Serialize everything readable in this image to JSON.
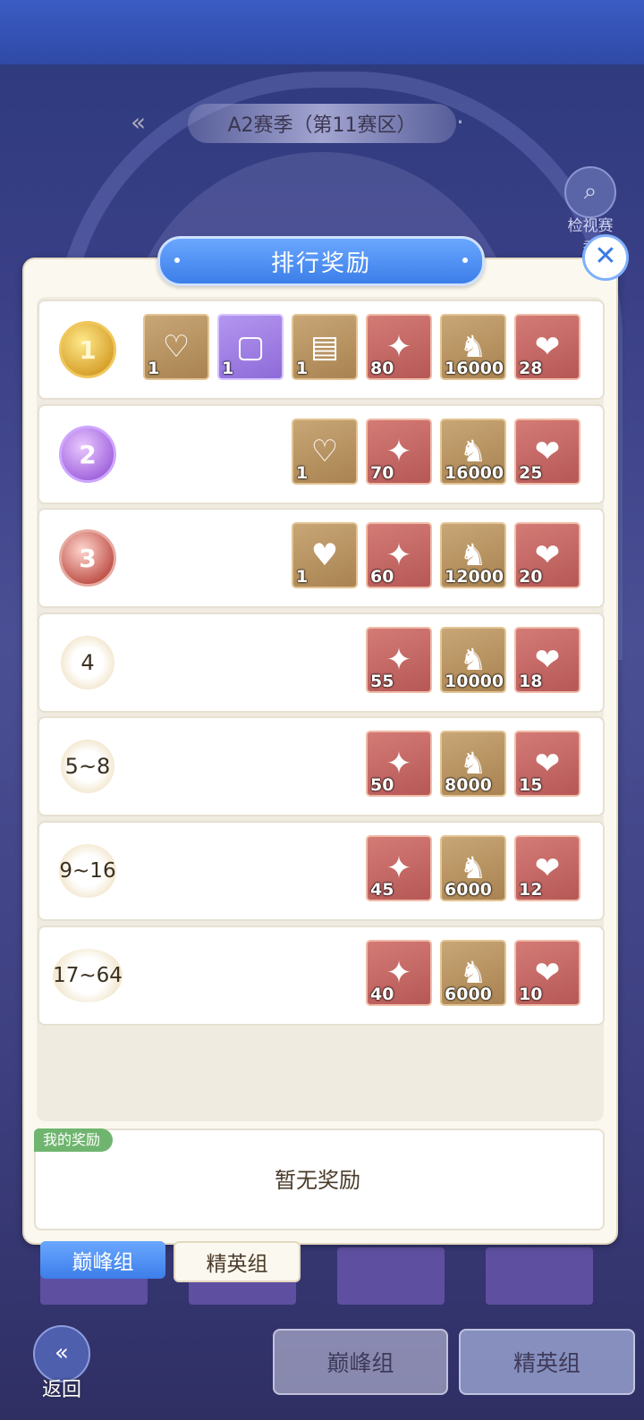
{
  "season": {
    "label": "A2赛季（第11赛区）"
  },
  "view_season": {
    "label": "检视赛季"
  },
  "panel": {
    "title": "排行奖励",
    "close_icon": "close-icon"
  },
  "ranks": [
    {
      "label": "1",
      "items": [
        {
          "icon": "silver-heart-emblem-icon",
          "qty": "1",
          "bg": "brown"
        },
        {
          "icon": "golden-frame-icon",
          "qty": "1",
          "bg": "purple"
        },
        {
          "icon": "title-card-icon",
          "qty": "1",
          "bg": "brown"
        },
        {
          "icon": "character-token-icon",
          "qty": "80",
          "bg": "red"
        },
        {
          "icon": "dragon-icon",
          "qty": "16000",
          "bg": "brown"
        },
        {
          "icon": "lips-icon",
          "qty": "28",
          "bg": "red"
        }
      ]
    },
    {
      "label": "2",
      "items": [
        {
          "icon": "silver-heart-emblem-icon",
          "qty": "1",
          "bg": "brown"
        },
        {
          "icon": "character-token-icon",
          "qty": "70",
          "bg": "red"
        },
        {
          "icon": "dragon-icon",
          "qty": "16000",
          "bg": "brown"
        },
        {
          "icon": "lips-icon",
          "qty": "25",
          "bg": "red"
        }
      ]
    },
    {
      "label": "3",
      "items": [
        {
          "icon": "dark-heart-emblem-icon",
          "qty": "1",
          "bg": "brown"
        },
        {
          "icon": "character-token-icon",
          "qty": "60",
          "bg": "red"
        },
        {
          "icon": "dragon-icon",
          "qty": "12000",
          "bg": "brown"
        },
        {
          "icon": "lips-icon",
          "qty": "20",
          "bg": "red"
        }
      ]
    },
    {
      "label": "4",
      "items": [
        {
          "icon": "character-token-icon",
          "qty": "55",
          "bg": "red"
        },
        {
          "icon": "dragon-icon",
          "qty": "10000",
          "bg": "brown"
        },
        {
          "icon": "lips-icon",
          "qty": "18",
          "bg": "red"
        }
      ]
    },
    {
      "label": "5~8",
      "items": [
        {
          "icon": "character-token-icon",
          "qty": "50",
          "bg": "red"
        },
        {
          "icon": "dragon-icon",
          "qty": "8000",
          "bg": "brown"
        },
        {
          "icon": "lips-icon",
          "qty": "15",
          "bg": "red"
        }
      ]
    },
    {
      "label": "9~16",
      "items": [
        {
          "icon": "character-token-icon",
          "qty": "45",
          "bg": "red"
        },
        {
          "icon": "dragon-icon",
          "qty": "6000",
          "bg": "brown"
        },
        {
          "icon": "lips-icon",
          "qty": "12",
          "bg": "red"
        }
      ]
    },
    {
      "label": "17~64",
      "items": [
        {
          "icon": "character-token-icon",
          "qty": "40",
          "bg": "red"
        },
        {
          "icon": "dragon-icon",
          "qty": "6000",
          "bg": "brown"
        },
        {
          "icon": "lips-icon",
          "qty": "10",
          "bg": "red"
        }
      ]
    }
  ],
  "my_reward": {
    "tag": "我的奖励",
    "text": "暂无奖励"
  },
  "tabs": {
    "peak": "巅峰组",
    "elite": "精英组"
  },
  "bottom": {
    "peak": "巅峰组",
    "elite": "精英组",
    "back": "返回"
  }
}
